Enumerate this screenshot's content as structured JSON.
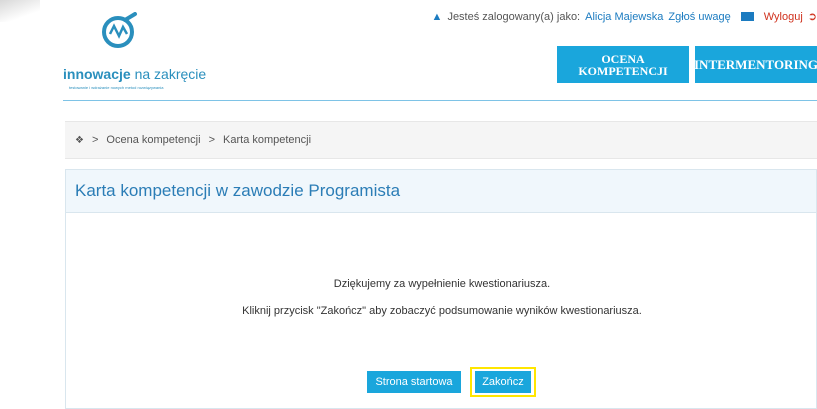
{
  "header": {
    "logo": {
      "bold": "innowacje",
      "light": " na zakręcie",
      "tagline": "testowanie i wdrażanie nowych metod rozwiązywania"
    },
    "user": {
      "label": "Jesteś zalogowany(a) jako:",
      "name": "Alicja Majewska",
      "report_link": "Zgłoś uwagę",
      "logout": "Wyloguj"
    },
    "nav": [
      {
        "line1": "OCENA",
        "line2": "KOMPETENCJI"
      },
      {
        "label": "INTERMENTORING"
      }
    ]
  },
  "breadcrumb": {
    "items": [
      "Ocena kompetencji",
      "Karta kompetencji"
    ],
    "separator": ">"
  },
  "panel": {
    "title": "Karta kompetencji w zawodzie Programista",
    "thanks": "Dziękujemy za wypełnienie kwestionariusza.",
    "instruction": "Kliknij przycisk \"Zakończ\" aby zobaczyć podsumowanie wyników kwestionariusza.",
    "buttons": {
      "start": "Strona startowa",
      "finish": "Zakończ"
    }
  },
  "colors": {
    "accent": "#1aa6dc",
    "link": "#1b7bc0",
    "highlight": "#ffe600",
    "logout": "#d0321e"
  }
}
